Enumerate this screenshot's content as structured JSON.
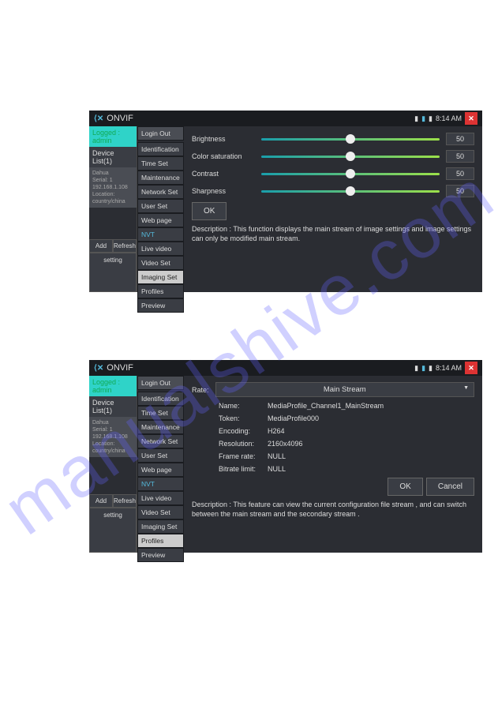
{
  "watermark": "manualshive.com",
  "app_title": "ONVIF",
  "status_time": "8:14 AM",
  "left": {
    "logged": "Logged : admin",
    "device_list_header": "Device List(1)",
    "device_name": "Dahua",
    "device_serial": "Serial: 1",
    "device_ip": "192.168.1.108",
    "device_loc": "Location: country/china",
    "add": "Add",
    "refresh": "Refresh",
    "setting": "setting"
  },
  "mid": {
    "logout": "Login Out",
    "items": [
      "Identification",
      "Time Set",
      "Maintenance",
      "Network Set",
      "User Set",
      "Web page",
      "NVT",
      "Live video",
      "Video Set",
      "Imaging Set",
      "Profiles",
      "Preview"
    ]
  },
  "shot1": {
    "sliders": [
      {
        "label": "Brightness",
        "value": "50"
      },
      {
        "label": "Color saturation",
        "value": "50"
      },
      {
        "label": "Contrast",
        "value": "50"
      },
      {
        "label": "Sharpness",
        "value": "50"
      }
    ],
    "ok": "OK",
    "desc": "Description : This function displays the main stream of image settings and image settings can only be modified main stream."
  },
  "shot2": {
    "rate_label": "Rate:",
    "rate_value": "Main Stream",
    "rows": [
      {
        "k": "Name:",
        "v": "MediaProfile_Channel1_MainStream"
      },
      {
        "k": "Token:",
        "v": "MediaProfile000"
      },
      {
        "k": "Encoding:",
        "v": "H264"
      },
      {
        "k": "Resolution:",
        "v": "2160x4096"
      },
      {
        "k": "Frame rate:",
        "v": "NULL"
      },
      {
        "k": "Bitrate limit:",
        "v": "NULL"
      }
    ],
    "ok": "OK",
    "cancel": "Cancel",
    "desc": "Description : This feature can view the current configuration file stream , and can switch between the main stream and the secondary stream ."
  }
}
